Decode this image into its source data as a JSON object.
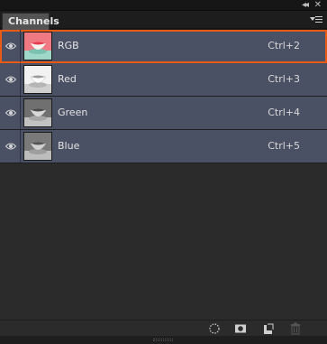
{
  "panel": {
    "tab_label": "Channels",
    "collapse_glyph": "◂◂",
    "close_glyph": "✕"
  },
  "channels": [
    {
      "name": "RGB",
      "shortcut": "Ctrl+2",
      "visible": true,
      "selected": true
    },
    {
      "name": "Red",
      "shortcut": "Ctrl+3",
      "visible": true,
      "selected": false
    },
    {
      "name": "Green",
      "shortcut": "Ctrl+4",
      "visible": true,
      "selected": false
    },
    {
      "name": "Blue",
      "shortcut": "Ctrl+5",
      "visible": true,
      "selected": false
    }
  ],
  "footer_icons": [
    "load-selection-icon",
    "save-selection-icon",
    "new-channel-icon",
    "delete-channel-icon"
  ],
  "colors": {
    "row_bg": "#4a5165",
    "selection_outline": "#e85a16",
    "panel_bg": "#2b2b2b"
  }
}
